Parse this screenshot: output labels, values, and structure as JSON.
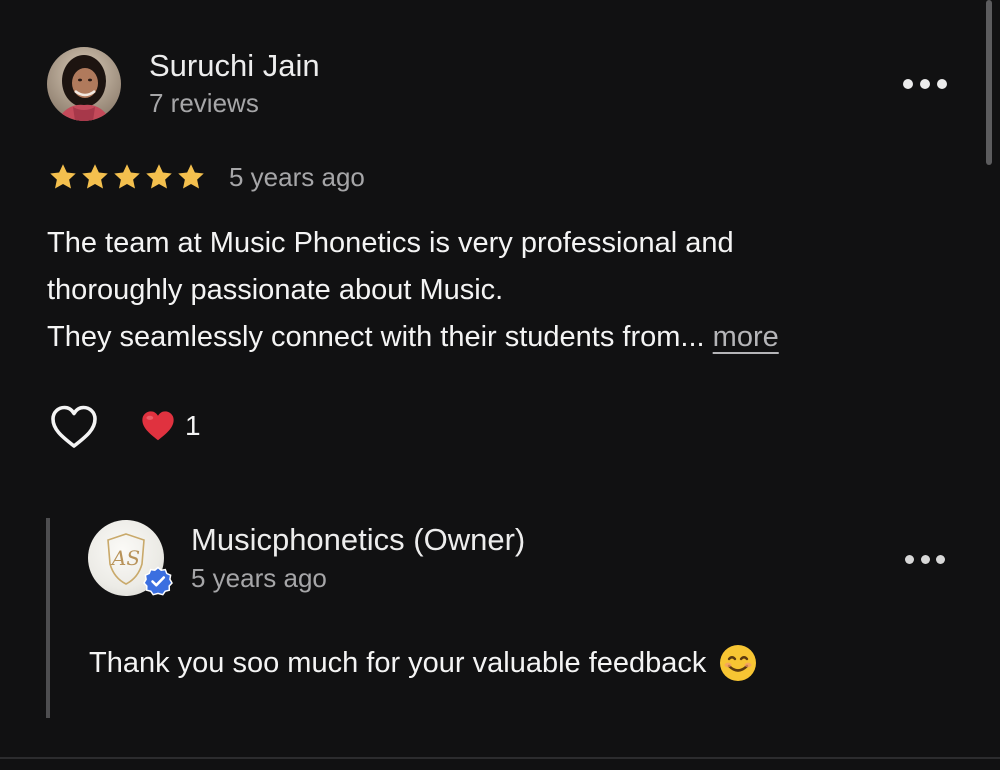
{
  "review": {
    "reviewer_name": "Suruchi Jain",
    "reviewer_meta": "7 reviews",
    "rating": 5,
    "date": "5 years ago",
    "body_lines": [
      "The team at Music Phonetics is very professional and",
      "thoroughly passionate about Music.",
      "They seamlessly connect with their students from..."
    ],
    "more_label": "more",
    "reaction_count": "1"
  },
  "owner_reply": {
    "name": "Musicphonetics (Owner)",
    "date": "5 years ago",
    "text": "Thank you soo much for your valuable feedback",
    "logo_text": "AS"
  },
  "icons": {
    "more_menu": "more-horizontal-icon",
    "star": "star-icon",
    "like": "heart-outline-icon",
    "reaction": "red-heart-emoji-icon",
    "verified": "verified-badge-icon",
    "emoji": "smiling-face-emoji-icon"
  },
  "colors": {
    "background": "#111112",
    "star": "#f4c04e",
    "reaction_heart": "#e0323f",
    "verified": "#3b6fe0",
    "emoji": "#f7c533"
  }
}
